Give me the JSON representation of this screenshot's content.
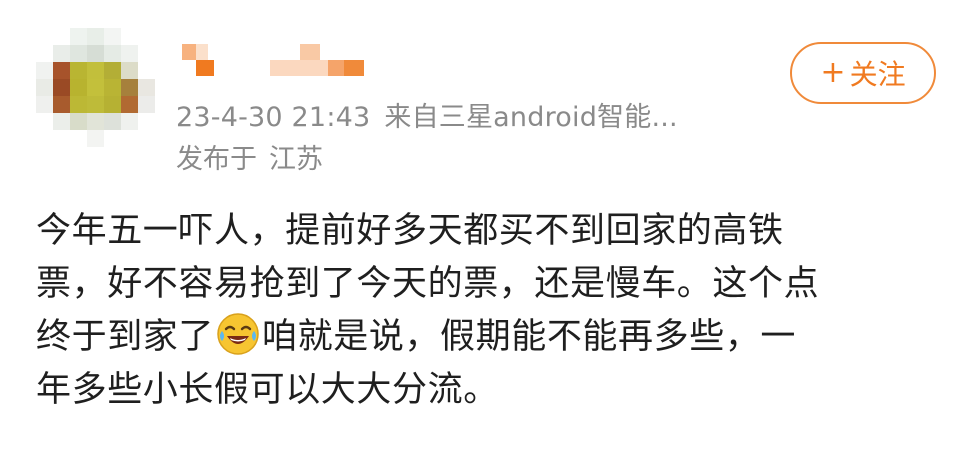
{
  "post": {
    "meta": {
      "time": "23-4-30 21:43",
      "source": "来自三星android智能...",
      "location_prefix": "发布于",
      "location": "江苏"
    },
    "follow_button": {
      "plus": "+",
      "label": "关注"
    },
    "body": {
      "line1": "今年五一吓人，提前好多天都买不到回家的高铁",
      "line2": "票，好不容易抢到了今天的票，还是慢车。这个点",
      "line3_before_emoji": "终于到家了",
      "emoji_icon": "laughing-crying-emoji-icon",
      "line3_after_emoji": "咱就是说，假期能不能再多些，一",
      "line4": "年多些小长假可以大大分流。"
    }
  },
  "colors": {
    "accent": "#f08a3a",
    "meta_text": "#8a8a8a",
    "body_text": "#1f1f1f"
  }
}
